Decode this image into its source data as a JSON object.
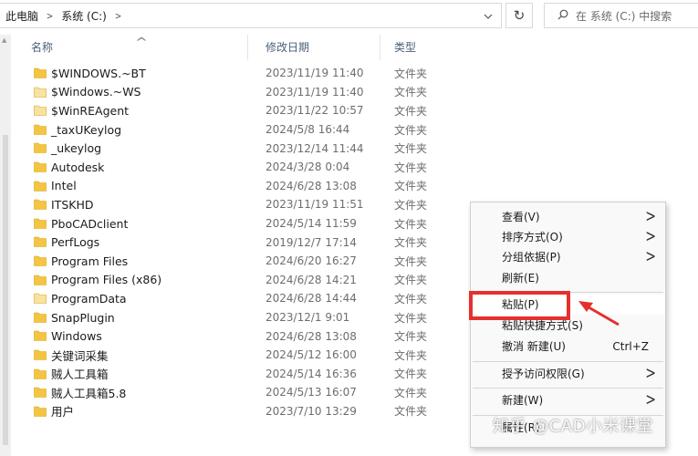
{
  "breadcrumb": {
    "root": "此电脑",
    "drive": "系统 (C:)"
  },
  "search": {
    "placeholder": "在 系统 (C:) 中搜索"
  },
  "columns": {
    "name": "名称",
    "date": "修改日期",
    "type": "类型"
  },
  "files": [
    {
      "name": "$WINDOWS.~BT",
      "date": "2023/11/19 11:40",
      "type": "文件夹",
      "faded": false
    },
    {
      "name": "$Windows.~WS",
      "date": "2023/11/19 11:40",
      "type": "文件夹",
      "faded": true
    },
    {
      "name": "$WinREAgent",
      "date": "2023/11/22 10:57",
      "type": "文件夹",
      "faded": true
    },
    {
      "name": "_taxUKeylog",
      "date": "2024/5/8 16:44",
      "type": "文件夹",
      "faded": false
    },
    {
      "name": "_ukeylog",
      "date": "2023/12/14 11:44",
      "type": "文件夹",
      "faded": false
    },
    {
      "name": "Autodesk",
      "date": "2024/3/28 0:04",
      "type": "文件夹",
      "faded": false
    },
    {
      "name": "Intel",
      "date": "2024/6/28 13:08",
      "type": "文件夹",
      "faded": false
    },
    {
      "name": "ITSKHD",
      "date": "2023/11/19 11:51",
      "type": "文件夹",
      "faded": false
    },
    {
      "name": "PboCADclient",
      "date": "2024/5/14 11:59",
      "type": "文件夹",
      "faded": false
    },
    {
      "name": "PerfLogs",
      "date": "2019/12/7 17:14",
      "type": "文件夹",
      "faded": false
    },
    {
      "name": "Program Files",
      "date": "2024/6/20 16:27",
      "type": "文件夹",
      "faded": false
    },
    {
      "name": "Program Files (x86)",
      "date": "2024/6/28 14:21",
      "type": "文件夹",
      "faded": false
    },
    {
      "name": "ProgramData",
      "date": "2024/6/28 14:44",
      "type": "文件夹",
      "faded": true
    },
    {
      "name": "SnapPlugin",
      "date": "2023/12/1 9:01",
      "type": "文件夹",
      "faded": false
    },
    {
      "name": "Windows",
      "date": "2024/6/28 13:08",
      "type": "文件夹",
      "faded": false
    },
    {
      "name": "关键词采集",
      "date": "2024/5/12 16:00",
      "type": "文件夹",
      "faded": false
    },
    {
      "name": "贼人工具箱",
      "date": "2024/5/14 16:36",
      "type": "文件夹",
      "faded": false
    },
    {
      "name": "贼人工具箱5.8",
      "date": "2024/5/13 16:07",
      "type": "文件夹",
      "faded": false
    },
    {
      "name": "用户",
      "date": "2023/7/10 13:29",
      "type": "文件夹",
      "faded": false
    }
  ],
  "context_menu": {
    "view": "查看(V)",
    "sort": "排序方式(O)",
    "group": "分组依据(P)",
    "refresh": "刷新(E)",
    "paste": "粘贴(P)",
    "paste_shortcut": "粘贴快捷方式(S)",
    "undo": "撤消 新建(U)",
    "undo_shortcut": "Ctrl+Z",
    "grant_access": "授予访问权限(G)",
    "new": "新建(W)",
    "properties": "属性(R)"
  },
  "watermark": "知乎 @CAD小米课堂",
  "colors": {
    "highlight": "#e5302d",
    "folder": "#f4c542",
    "folder_faded": "#f7e3a1"
  }
}
